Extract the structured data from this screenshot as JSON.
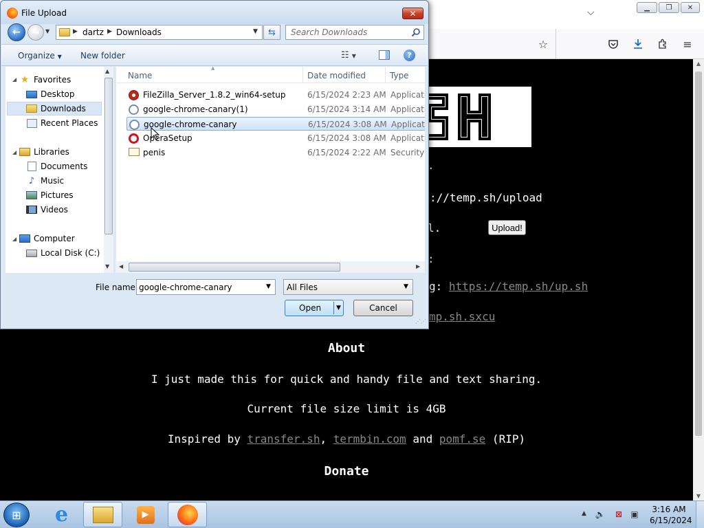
{
  "dialog": {
    "title": "File Upload",
    "close_label": "✕",
    "breadcrumb": [
      "dartz",
      "Downloads"
    ],
    "search_placeholder": "Search Downloads",
    "toolbar": {
      "organize_label": "Organize",
      "new_folder_label": "New folder"
    },
    "nav": {
      "favorites_label": "Favorites",
      "favorites": [
        "Desktop",
        "Downloads",
        "Recent Places"
      ],
      "libraries_label": "Libraries",
      "libraries": [
        "Documents",
        "Music",
        "Pictures",
        "Videos"
      ],
      "computer_label": "Computer",
      "drives": [
        "Local Disk (C:)"
      ],
      "selected": "Downloads"
    },
    "columns": {
      "name": "Name",
      "date": "Date modified",
      "type": "Type"
    },
    "files": [
      {
        "name": "FileZilla_Server_1.8.2_win64-setup",
        "date": "6/15/2024 2:23 AM",
        "type": "Applicatio",
        "icon": "filezilla-icon"
      },
      {
        "name": "google-chrome-canary(1)",
        "date": "6/15/2024 3:14 AM",
        "type": "Applicatio",
        "icon": "installer-icon"
      },
      {
        "name": "google-chrome-canary",
        "date": "6/15/2024 3:08 AM",
        "type": "Applicatio",
        "icon": "installer-icon",
        "selected": true
      },
      {
        "name": "OperaSetup",
        "date": "6/15/2024 3:08 AM",
        "type": "Applicatio",
        "icon": "opera-icon"
      },
      {
        "name": "penis",
        "date": "6/15/2024 2:22 AM",
        "type": "Security C",
        "icon": "certificate-icon"
      }
    ],
    "file_name_label": "File name:",
    "file_name_value": "google-chrome-canary",
    "file_type_value": "All Files",
    "open_label": "Open",
    "cancel_label": "Cancel"
  },
  "page": {
    "upload_url_text": "://temp.sh/upload",
    "upload_button_label": "Upload!",
    "script_prefix": "g: ",
    "script_link": "https://temp.sh/up.sh",
    "sharex_link": "mp.sh.sxcu",
    "about_heading": "About",
    "about_line1": "I just made this for quick and handy file and text sharing.",
    "about_line2": "Current file size limit is 4GB",
    "inspired_prefix": "Inspired by ",
    "inspired_link1": "transfer.sh",
    "inspired_sep1": ", ",
    "inspired_link2": "termbin.com",
    "inspired_sep2": " and ",
    "inspired_link3": "pomf.se",
    "inspired_suffix": " (RIP)",
    "donate_heading": "Donate",
    "fragment_1": ".",
    "fragment_2": "l.",
    "fragment_3": ":"
  },
  "taskbar": {
    "time": "3:16 AM",
    "date": "6/15/2024"
  },
  "colors": {
    "page_bg": "#000000",
    "link": "#888888",
    "selection": "#cfe2f8",
    "taskbar": "#b8d0ea"
  }
}
